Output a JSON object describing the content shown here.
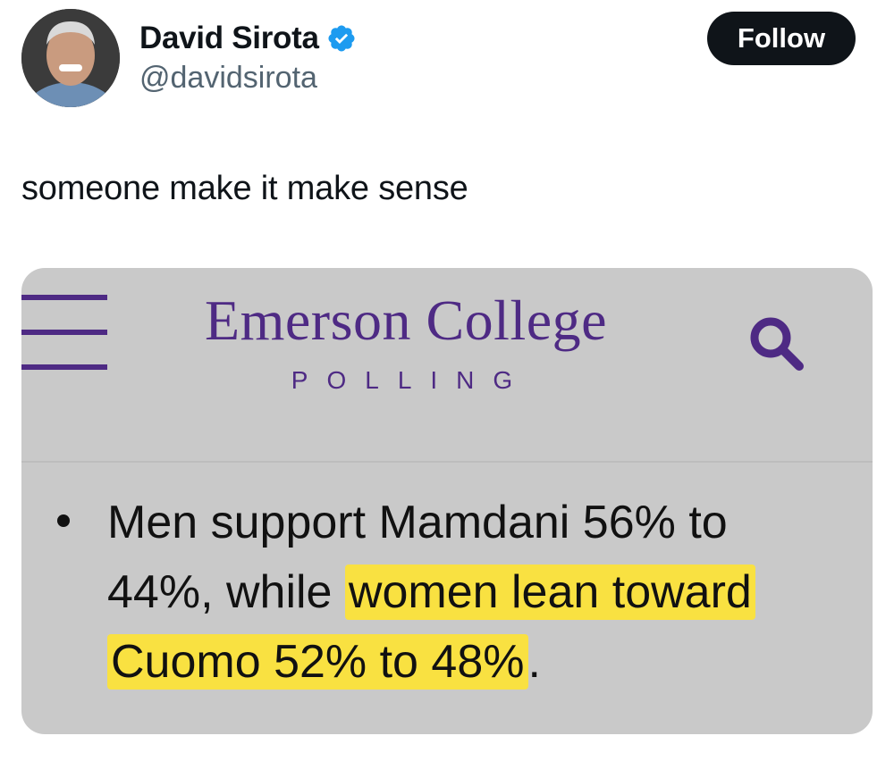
{
  "author": {
    "display_name": "David Sirota",
    "handle": "@davidsirota",
    "verified": true,
    "avatar_icon": "profile-photo",
    "verified_color": "#1d9bf0"
  },
  "actions": {
    "follow_label": "Follow"
  },
  "tweet": {
    "text": "someone make it make sense"
  },
  "media": {
    "brand_title": "Emerson College",
    "brand_subtitle": "POLLING",
    "brand_color": "#4e2a84",
    "menu_icon": "hamburger-menu-icon",
    "search_icon": "search-icon",
    "bullet": {
      "text_plain": "Men support Mamdani 56% to 44%, while ",
      "text_highlighted": "women lean toward Cuomo 52% to 48%",
      "text_end": ".",
      "highlight_color": "#f9e141"
    }
  }
}
